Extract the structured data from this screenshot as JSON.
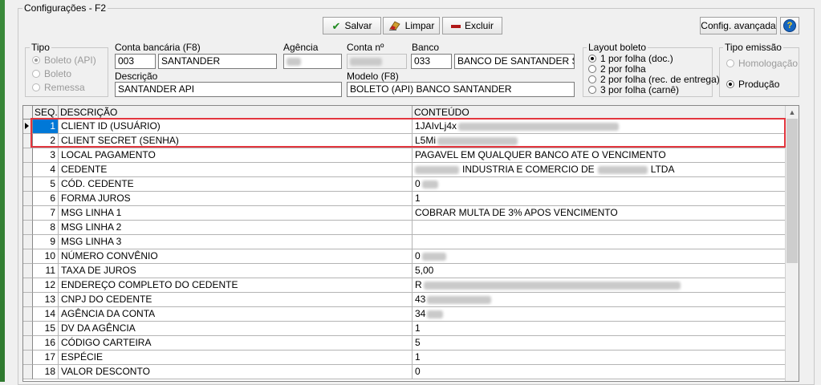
{
  "window": {
    "title": "Configurações - F2"
  },
  "toolbar": {
    "save_label": "Salvar",
    "clear_label": "Limpar",
    "delete_label": "Excluir",
    "advanced_label": "Config. avançada",
    "help_label": "?"
  },
  "tipo": {
    "legend": "Tipo",
    "options": [
      "Boleto (API)",
      "Boleto",
      "Remessa"
    ],
    "selected": "Boleto (API)"
  },
  "form": {
    "conta_bancaria_label": "Conta bancária (F8)",
    "conta_bancaria_code": "003",
    "conta_bancaria_name": "SANTANDER",
    "agencia_label": "Agência",
    "conta_label": "Conta nº",
    "banco_label": "Banco",
    "banco_code": "033",
    "banco_name": "BANCO DE SANTANDER S/A",
    "descricao_label": "Descrição",
    "descricao_value": "SANTANDER API",
    "modelo_label": "Modelo (F8)",
    "modelo_value": "BOLETO (API) BANCO SANTANDER"
  },
  "layout_boleto": {
    "legend": "Layout boleto",
    "options": [
      "1 por folha (doc.)",
      "2 por folha",
      "2 por folha (rec. de entrega)",
      "3 por folha (carnê)"
    ],
    "selected": "1 por folha (doc.)"
  },
  "tipo_emissao": {
    "legend": "Tipo emissão",
    "options": [
      "Homologação",
      "Produção"
    ],
    "selected": "Produção"
  },
  "grid": {
    "columns": [
      "SEQ.",
      "DESCRIÇÃO",
      "CONTEÚDO"
    ],
    "rows": [
      {
        "seq": "1",
        "desc": "CLIENT ID (USUÁRIO)",
        "cont": "1JAIvLj4x"
      },
      {
        "seq": "2",
        "desc": "CLIENT SECRET (SENHA)",
        "cont": "L5Mi"
      },
      {
        "seq": "3",
        "desc": "LOCAL PAGAMENTO",
        "cont": "PAGAVEL EM QUALQUER BANCO ATE O VENCIMENTO"
      },
      {
        "seq": "4",
        "desc": "CEDENTE",
        "cont": "INDUSTRIA E COMERCIO DE"
      },
      {
        "seq": "5",
        "desc": "CÓD. CEDENTE",
        "cont": "0"
      },
      {
        "seq": "6",
        "desc": "FORMA JUROS",
        "cont": "1"
      },
      {
        "seq": "7",
        "desc": "MSG LINHA 1",
        "cont": "COBRAR MULTA DE 3% APOS VENCIMENTO"
      },
      {
        "seq": "8",
        "desc": "MSG LINHA 2",
        "cont": ""
      },
      {
        "seq": "9",
        "desc": "MSG LINHA 3",
        "cont": ""
      },
      {
        "seq": "10",
        "desc": "NÚMERO CONVÊNIO",
        "cont": "0"
      },
      {
        "seq": "11",
        "desc": "TAXA DE JUROS",
        "cont": "5,00"
      },
      {
        "seq": "12",
        "desc": "ENDEREÇO COMPLETO DO CEDENTE",
        "cont": "R"
      },
      {
        "seq": "13",
        "desc": "CNPJ DO CEDENTE",
        "cont": "43"
      },
      {
        "seq": "14",
        "desc": "AGÊNCIA DA CONTA",
        "cont": "34"
      },
      {
        "seq": "15",
        "desc": "DV DA AGÊNCIA",
        "cont": "1"
      },
      {
        "seq": "16",
        "desc": "CÓDIGO CARTEIRA",
        "cont": "5"
      },
      {
        "seq": "17",
        "desc": "ESPÉCIE",
        "cont": "1"
      },
      {
        "seq": "18",
        "desc": "VALOR DESCONTO",
        "cont": "0"
      }
    ],
    "cedente_suffix": "LTDA"
  },
  "colors": {
    "selection": "#0078d7",
    "highlight_border": "#e3373f",
    "save_icon": "#1f8a1f",
    "delete_icon": "#b01818",
    "help_bg": "#1565c0"
  }
}
